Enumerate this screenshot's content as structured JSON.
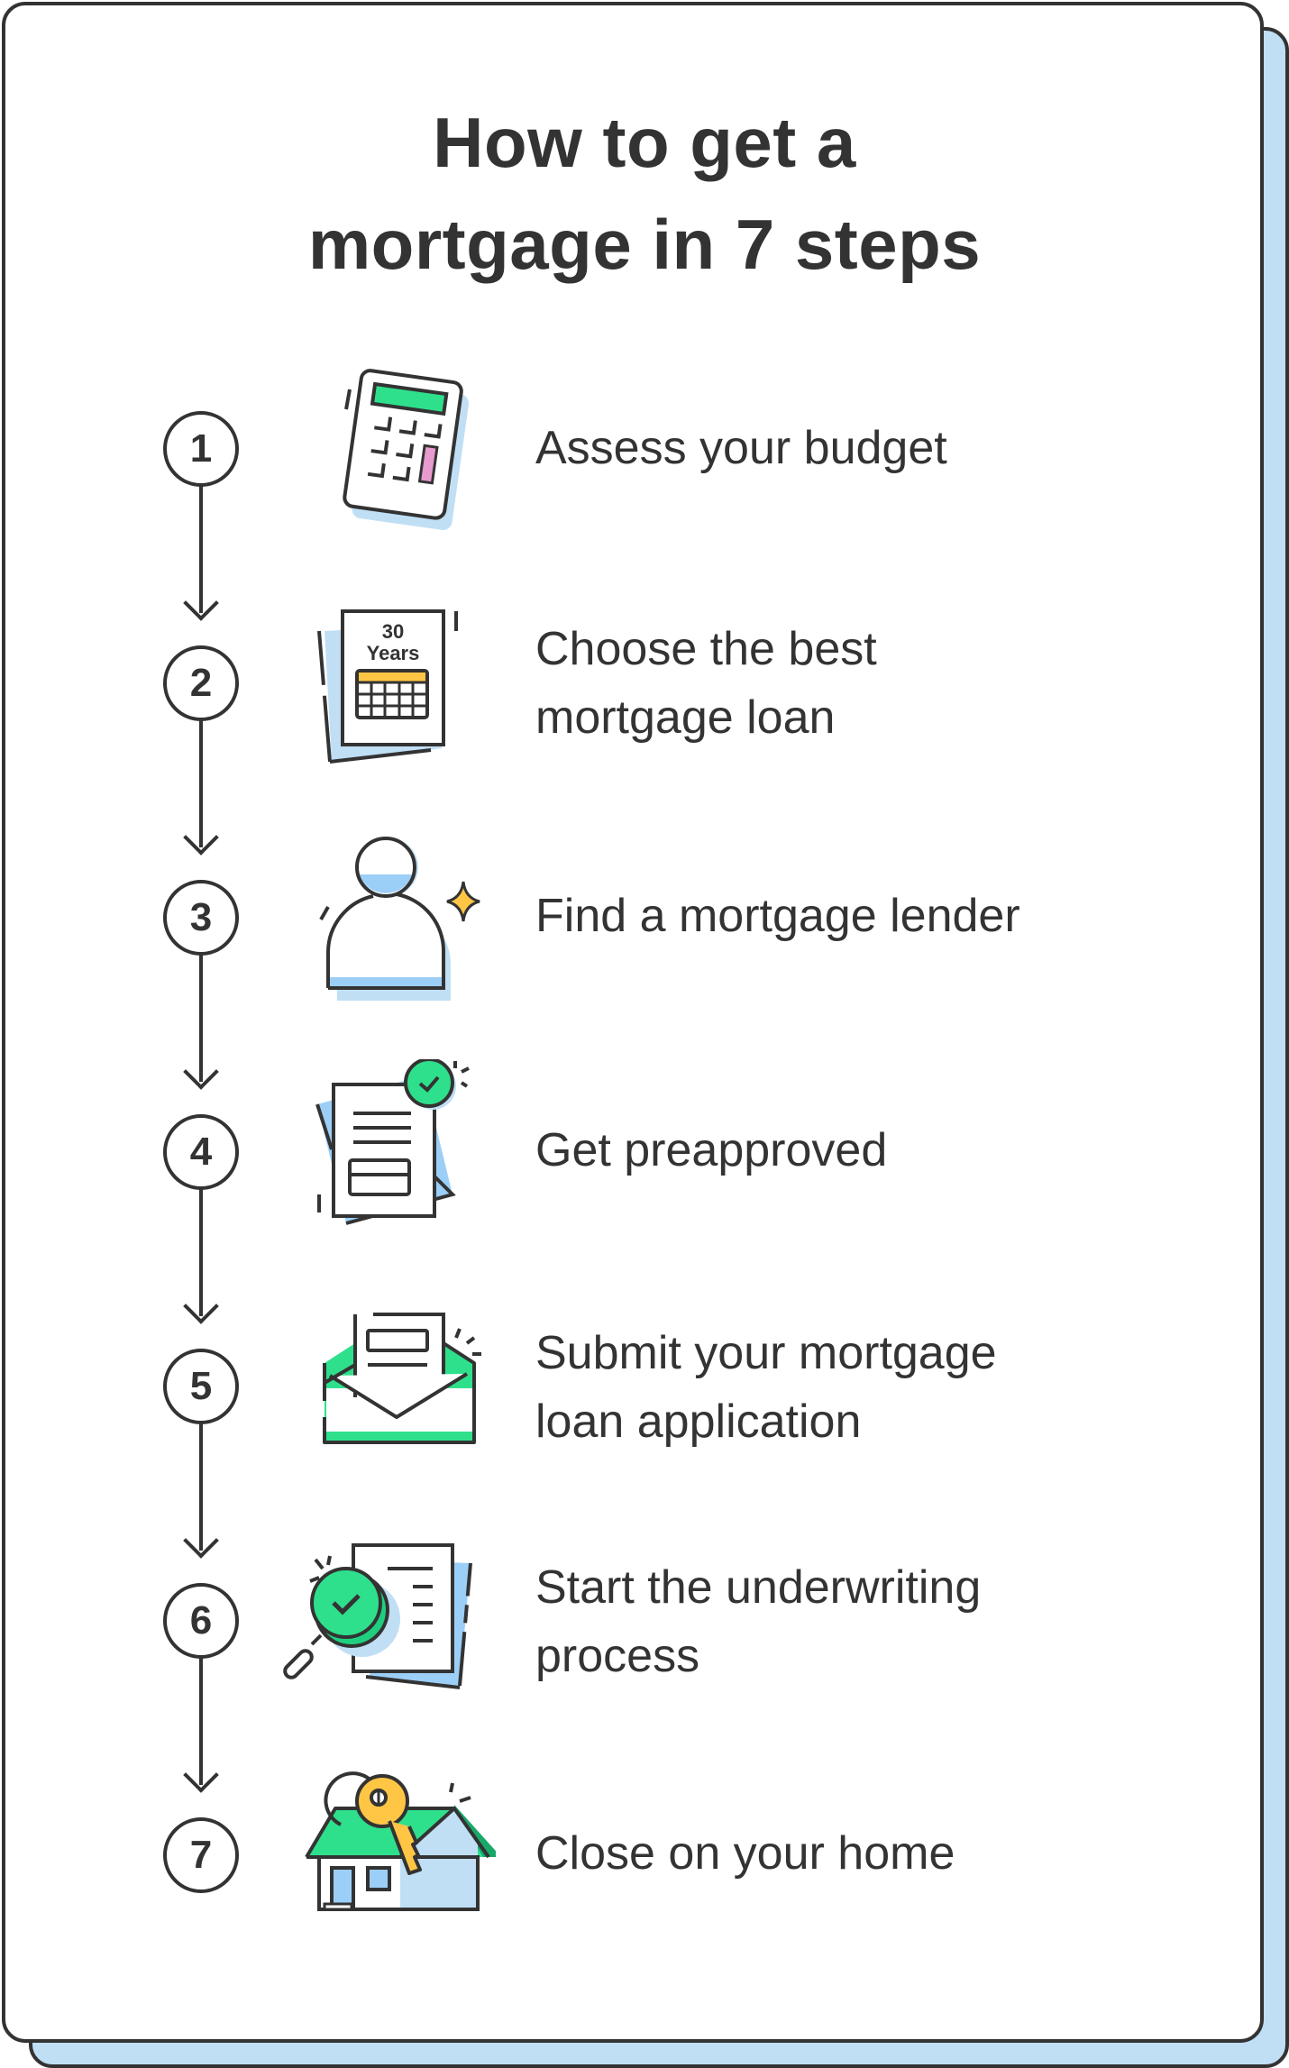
{
  "title": {
    "line1": "How to get a",
    "line2": "mortgage in 7 steps"
  },
  "colors": {
    "ink": "#333333",
    "card_shadow": "#c0dff5",
    "green": "#2ee08c",
    "dark_green": "#1aa86a",
    "light_blue": "#9ccff7",
    "pale_blue": "#c0dff5",
    "yellow": "#ffc645",
    "pink": "#e89bcf"
  },
  "steps": [
    {
      "number": "1",
      "label_lines": [
        "Assess your budget"
      ],
      "icon": "calculator-icon"
    },
    {
      "number": "2",
      "label_lines": [
        "Choose the best",
        "mortgage loan"
      ],
      "icon": "loan-term-calendar-icon",
      "icon_text": [
        "30",
        "Years"
      ]
    },
    {
      "number": "3",
      "label_lines": [
        "Find a mortgage lender"
      ],
      "icon": "person-sparkle-icon"
    },
    {
      "number": "4",
      "label_lines": [
        "Get preapproved"
      ],
      "icon": "approved-document-icon"
    },
    {
      "number": "5",
      "label_lines": [
        "Submit your mortgage",
        "loan application"
      ],
      "icon": "envelope-letter-icon"
    },
    {
      "number": "6",
      "label_lines": [
        "Start the underwriting",
        "process"
      ],
      "icon": "magnifier-document-icon"
    },
    {
      "number": "7",
      "label_lines": [
        "Close on your home"
      ],
      "icon": "house-key-icon"
    }
  ]
}
